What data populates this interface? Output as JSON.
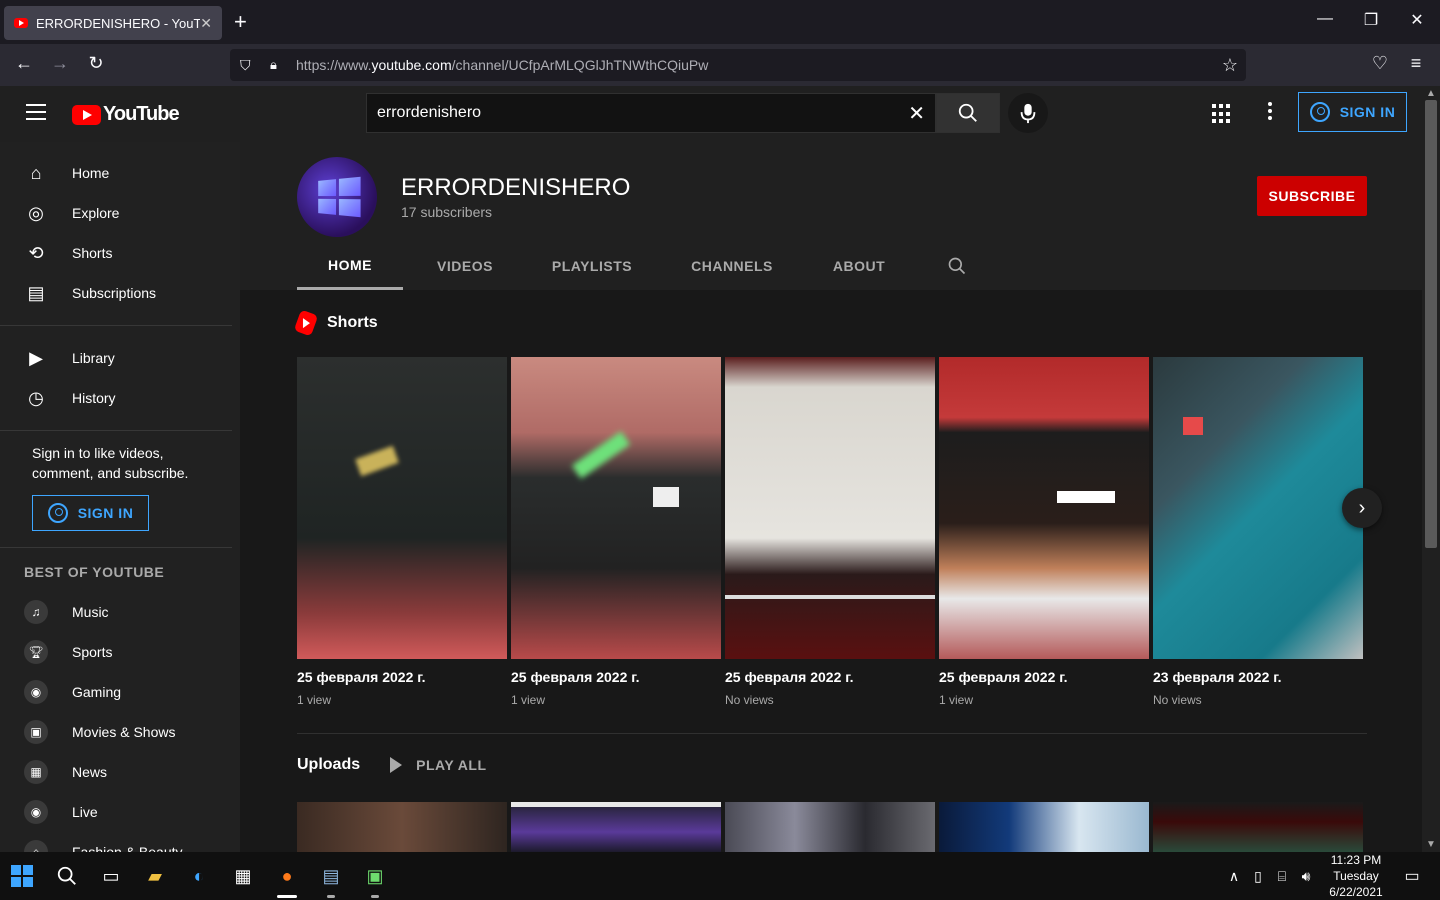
{
  "browser": {
    "tab_title": "ERRORDENISHERO - YouTube",
    "new_tab": "+",
    "url_prefix": "https://www.",
    "url_domain": "youtube.com",
    "url_path": "/channel/UCfpArMLQGlJhTNWthCQiuPw"
  },
  "masthead": {
    "logo_text": "YouTube",
    "search_value": "errordenishero",
    "sign_in": "SIGN IN"
  },
  "sidebar": {
    "main_items": [
      {
        "label": "Home",
        "icon": "home-icon"
      },
      {
        "label": "Explore",
        "icon": "compass-icon"
      },
      {
        "label": "Shorts",
        "icon": "shorts-icon"
      },
      {
        "label": "Subscriptions",
        "icon": "subscriptions-icon"
      }
    ],
    "library_items": [
      {
        "label": "Library",
        "icon": "library-icon"
      },
      {
        "label": "History",
        "icon": "history-icon"
      }
    ],
    "signin_prompt": "Sign in to like videos, comment, and subscribe.",
    "signin_button": "SIGN IN",
    "best_heading": "BEST OF YOUTUBE",
    "best_items": [
      {
        "label": "Music",
        "icon": "music-icon"
      },
      {
        "label": "Sports",
        "icon": "trophy-icon"
      },
      {
        "label": "Gaming",
        "icon": "gamepad-icon"
      },
      {
        "label": "Movies & Shows",
        "icon": "film-icon"
      },
      {
        "label": "News",
        "icon": "news-icon"
      },
      {
        "label": "Live",
        "icon": "live-icon"
      },
      {
        "label": "Fashion & Beauty",
        "icon": "hanger-icon"
      }
    ]
  },
  "channel": {
    "name": "ERRORDENISHERO",
    "subscribers": "17 subscribers",
    "subscribe_label": "SUBSCRIBE",
    "tabs": [
      "HOME",
      "VIDEOS",
      "PLAYLISTS",
      "CHANNELS",
      "ABOUT"
    ],
    "active_tab": "HOME"
  },
  "shorts": {
    "title": "Shorts",
    "items": [
      {
        "title": "25 февраля 2022 г.",
        "views": "1 view"
      },
      {
        "title": "25 февраля 2022 г.",
        "views": "1 view"
      },
      {
        "title": "25 февраля 2022 г.",
        "views": "No views"
      },
      {
        "title": "25 февраля 2022 г.",
        "views": "1 view"
      },
      {
        "title": "23 февраля 2022 г.",
        "views": "No views"
      }
    ]
  },
  "uploads": {
    "title": "Uploads",
    "play_all": "PLAY ALL"
  },
  "taskbar": {
    "time": "11:23 PM",
    "day": "Tuesday",
    "date": "6/22/2021"
  },
  "colors": {
    "subscribe": "#cc0000",
    "signin_accent": "#3ea6ff",
    "youtube_red": "#ff0000"
  }
}
